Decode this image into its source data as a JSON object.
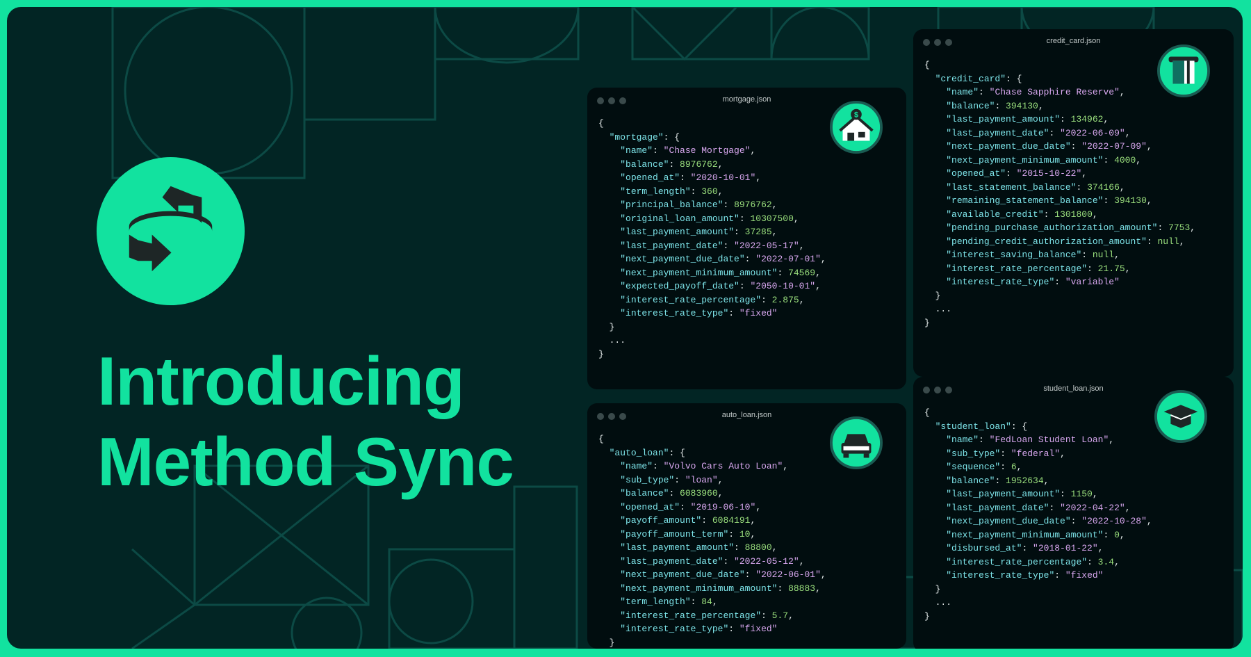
{
  "headline": {
    "line1": "Introducing",
    "line2": "Method Sync"
  },
  "cards": {
    "mortgage": {
      "filename": "mortgage.json",
      "icon": "house-icon",
      "root_key": "mortgage",
      "fields": [
        {
          "key": "name",
          "value": "Chase Mortgage",
          "type": "string"
        },
        {
          "key": "balance",
          "value": "8976762",
          "type": "number"
        },
        {
          "key": "opened_at",
          "value": "2020-10-01",
          "type": "string"
        },
        {
          "key": "term_length",
          "value": "360",
          "type": "number"
        },
        {
          "key": "principal_balance",
          "value": "8976762",
          "type": "number"
        },
        {
          "key": "original_loan_amount",
          "value": "10307500",
          "type": "number"
        },
        {
          "key": "last_payment_amount",
          "value": "37285",
          "type": "number"
        },
        {
          "key": "last_payment_date",
          "value": "2022-05-17",
          "type": "string"
        },
        {
          "key": "next_payment_due_date",
          "value": "2022-07-01",
          "type": "string"
        },
        {
          "key": "next_payment_minimum_amount",
          "value": "74569",
          "type": "number"
        },
        {
          "key": "expected_payoff_date",
          "value": "2050-10-01",
          "type": "string"
        },
        {
          "key": "interest_rate_percentage",
          "value": "2.875",
          "type": "number"
        },
        {
          "key": "interest_rate_type",
          "value": "fixed",
          "type": "string"
        }
      ]
    },
    "credit_card": {
      "filename": "credit_card.json",
      "icon": "credit-card-icon",
      "root_key": "credit_card",
      "fields": [
        {
          "key": "name",
          "value": "Chase Sapphire Reserve",
          "type": "string"
        },
        {
          "key": "balance",
          "value": "394130",
          "type": "number"
        },
        {
          "key": "last_payment_amount",
          "value": "134962",
          "type": "number"
        },
        {
          "key": "last_payment_date",
          "value": "2022-06-09",
          "type": "string"
        },
        {
          "key": "next_payment_due_date",
          "value": "2022-07-09",
          "type": "string"
        },
        {
          "key": "next_payment_minimum_amount",
          "value": "4000",
          "type": "number"
        },
        {
          "key": "opened_at",
          "value": "2015-10-22",
          "type": "string"
        },
        {
          "key": "last_statement_balance",
          "value": "374166",
          "type": "number"
        },
        {
          "key": "remaining_statement_balance",
          "value": "394130",
          "type": "number"
        },
        {
          "key": "available_credit",
          "value": "1301800",
          "type": "number"
        },
        {
          "key": "pending_purchase_authorization_amount",
          "value": "7753",
          "type": "number"
        },
        {
          "key": "pending_credit_authorization_amount",
          "value": "null",
          "type": "number"
        },
        {
          "key": "interest_saving_balance",
          "value": "null",
          "type": "number"
        },
        {
          "key": "interest_rate_percentage",
          "value": "21.75",
          "type": "number"
        },
        {
          "key": "interest_rate_type",
          "value": "variable",
          "type": "string"
        }
      ]
    },
    "auto_loan": {
      "filename": "auto_loan.json",
      "icon": "car-icon",
      "root_key": "auto_loan",
      "fields": [
        {
          "key": "name",
          "value": "Volvo Cars Auto Loan",
          "type": "string"
        },
        {
          "key": "sub_type",
          "value": "loan",
          "type": "string"
        },
        {
          "key": "balance",
          "value": "6083960",
          "type": "number"
        },
        {
          "key": "opened_at",
          "value": "2019-06-10",
          "type": "string"
        },
        {
          "key": "payoff_amount",
          "value": "6084191",
          "type": "number"
        },
        {
          "key": "payoff_amount_term",
          "value": "10",
          "type": "number"
        },
        {
          "key": "last_payment_amount",
          "value": "88800",
          "type": "number"
        },
        {
          "key": "last_payment_date",
          "value": "2022-05-12",
          "type": "string"
        },
        {
          "key": "next_payment_due_date",
          "value": "2022-06-01",
          "type": "string"
        },
        {
          "key": "next_payment_minimum_amount",
          "value": "88883",
          "type": "number"
        },
        {
          "key": "term_length",
          "value": "84",
          "type": "number"
        },
        {
          "key": "interest_rate_percentage",
          "value": "5.7",
          "type": "number"
        },
        {
          "key": "interest_rate_type",
          "value": "fixed",
          "type": "string"
        }
      ]
    },
    "student_loan": {
      "filename": "student_loan.json",
      "icon": "graduation-cap-icon",
      "root_key": "student_loan",
      "fields": [
        {
          "key": "name",
          "value": "FedLoan Student Loan",
          "type": "string"
        },
        {
          "key": "sub_type",
          "value": "federal",
          "type": "string"
        },
        {
          "key": "sequence",
          "value": "6",
          "type": "number"
        },
        {
          "key": "balance",
          "value": "1952634",
          "type": "number"
        },
        {
          "key": "last_payment_amount",
          "value": "1150",
          "type": "number"
        },
        {
          "key": "last_payment_date",
          "value": "2022-04-22",
          "type": "string"
        },
        {
          "key": "next_payment_due_date",
          "value": "2022-10-28",
          "type": "string"
        },
        {
          "key": "next_payment_minimum_amount",
          "value": "0",
          "type": "number"
        },
        {
          "key": "disbursed_at",
          "value": "2018-01-22",
          "type": "string"
        },
        {
          "key": "interest_rate_percentage",
          "value": "3.4",
          "type": "number"
        },
        {
          "key": "interest_rate_type",
          "value": "fixed",
          "type": "string"
        }
      ]
    }
  },
  "colors": {
    "accent": "#12e29f",
    "background": "#022524",
    "card": "#010d0f",
    "key": "#7ee5ea",
    "string": "#d9a8f0",
    "number": "#9be07e"
  }
}
